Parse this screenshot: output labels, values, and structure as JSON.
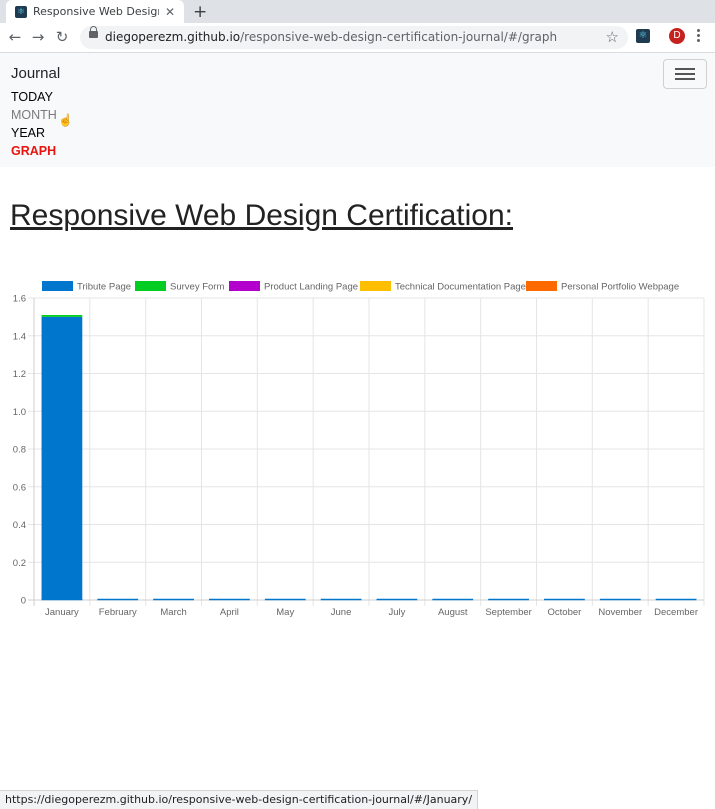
{
  "browser": {
    "tab_title": "Responsive Web Design Pr",
    "url_host": "diegoperezm.github.io",
    "url_path": "/responsive-web-design-certification-journal/#/graph",
    "status_url": "https://diegoperezm.github.io/responsive-web-design-certification-journal/#/January/",
    "avatar_letter": "D"
  },
  "navbar": {
    "brand": "Journal",
    "links": [
      "TODAY",
      "MONTH",
      "YEAR",
      "GRAPH"
    ],
    "active_color": "#e8140f"
  },
  "heading": "Responsive Web Design Certification:",
  "chart_data": {
    "type": "bar",
    "stacked": true,
    "categories": [
      "January",
      "February",
      "March",
      "April",
      "May",
      "June",
      "July",
      "August",
      "September",
      "October",
      "November",
      "December"
    ],
    "series": [
      {
        "name": "Tribute Page",
        "color": "#0077cc",
        "values": [
          1.5,
          0,
          0,
          0,
          0,
          0,
          0,
          0,
          0,
          0,
          0,
          0
        ]
      },
      {
        "name": "Survey Form",
        "color": "#00cc22",
        "values": [
          0.01,
          0,
          0,
          0,
          0,
          0,
          0,
          0,
          0,
          0,
          0,
          0
        ]
      },
      {
        "name": "Product Landing Page",
        "color": "#b300cc",
        "values": [
          0,
          0,
          0,
          0,
          0,
          0,
          0,
          0,
          0,
          0,
          0,
          0
        ]
      },
      {
        "name": "Technical Documentation Page",
        "color": "#ffbf00",
        "values": [
          0,
          0,
          0,
          0,
          0,
          0,
          0,
          0,
          0,
          0,
          0,
          0
        ]
      },
      {
        "name": "Personal Portfolio Webpage",
        "color": "#ff6a00",
        "values": [
          0,
          0,
          0,
          0,
          0,
          0,
          0,
          0,
          0,
          0,
          0,
          0
        ]
      }
    ],
    "y_ticks": [
      "0",
      "0.2",
      "0.4",
      "0.6",
      "0.8",
      "1.0",
      "1.2",
      "1.4",
      "1.6"
    ],
    "ylim": [
      0,
      1.6
    ],
    "grid": true,
    "legend": "top"
  }
}
